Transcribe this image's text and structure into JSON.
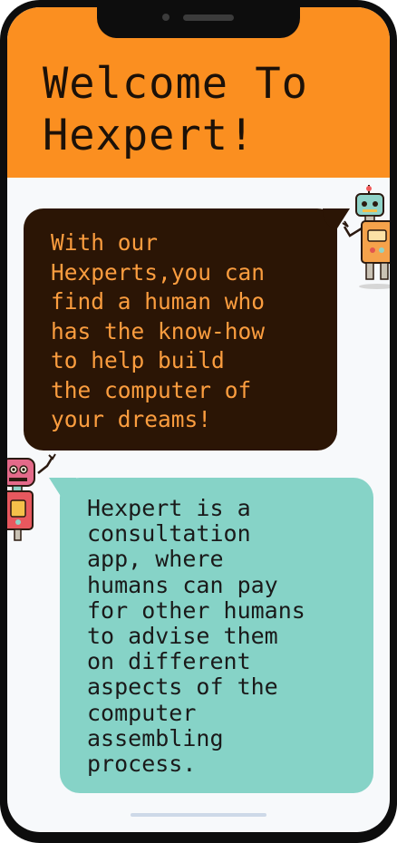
{
  "header": {
    "title": "Welcome To Hexpert!"
  },
  "messages": [
    {
      "text": "With our\nHexperts,you can\nfind a human who\nhas the know-how\nto help build\nthe computer of\nyour dreams!"
    },
    {
      "text": "Hexpert is a\nconsultation\napp, where\nhumans can pay\nfor other humans\nto advise them\non different\naspects of the\ncomputer\nassembling\nprocess."
    }
  ],
  "icons": {
    "right_robot": "robot-icon",
    "left_robot": "robot-icon"
  },
  "colors": {
    "header_bg": "#fb8f20",
    "dark_bubble_bg": "#2b1505",
    "dark_bubble_text": "#fb9d3f",
    "teal_bubble_bg": "#86d3c7"
  }
}
